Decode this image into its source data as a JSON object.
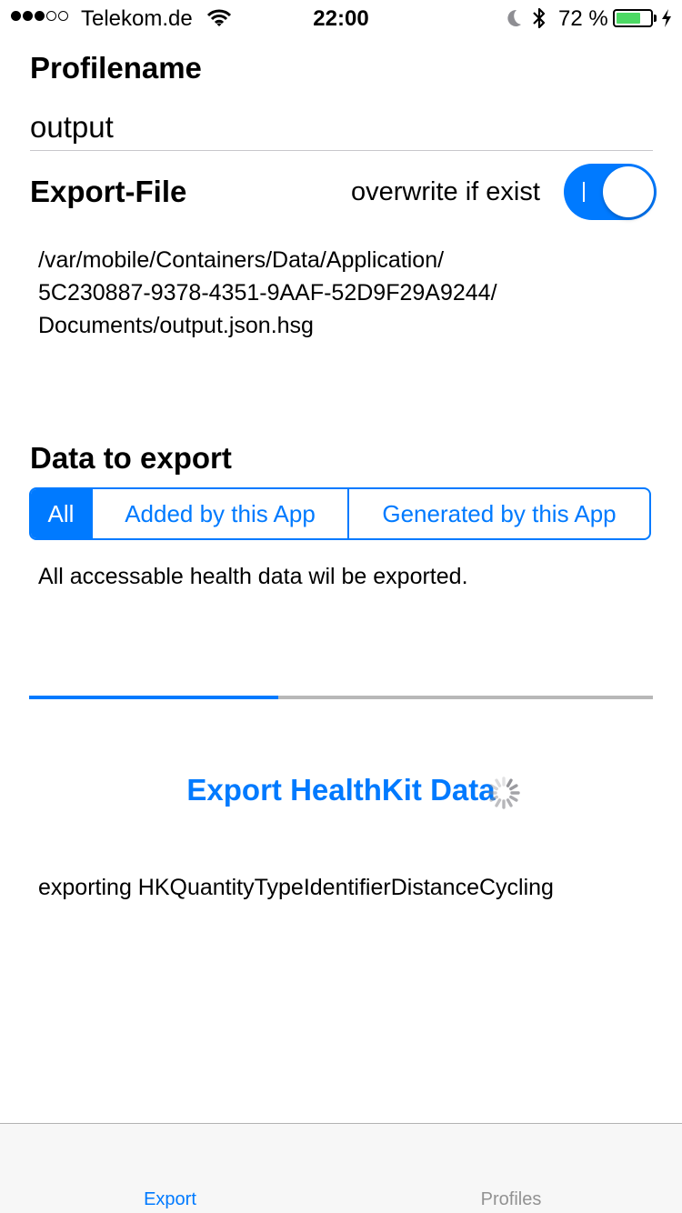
{
  "status_bar": {
    "carrier": "Telekom.de",
    "time": "22:00",
    "battery_percent": "72 %",
    "battery_level": 0.72,
    "signal_bars_filled": 3,
    "signal_bars_total": 5
  },
  "profile": {
    "title": "Profilename",
    "value": "output"
  },
  "export_file": {
    "title": "Export-File",
    "overwrite_label": "overwrite if exist",
    "overwrite_enabled": true,
    "path_lines": [
      "/var/mobile/Containers/Data/Application/",
      "5C230887-9378-4351-9AAF-52D9F29A9244/",
      "Documents/output.json.hsg"
    ]
  },
  "data_to_export": {
    "title": "Data to export",
    "segments": [
      "All",
      "Added by this App",
      "Generated by this App"
    ],
    "selected_segment": "All",
    "description": "All accessable health data wil be exported."
  },
  "progress": {
    "fraction": 0.4
  },
  "export": {
    "button_label": "Export HealthKit Data",
    "status": "exporting HKQuantityTypeIdentifierDistanceCycling"
  },
  "tab_bar": {
    "tabs": [
      "Export",
      "Profiles"
    ],
    "selected": "Export"
  },
  "colors": {
    "accent": "#007aff",
    "battery": "#4cd964",
    "inactive_tab": "#929292"
  },
  "icons": [
    "signal-strength-icon",
    "wifi-icon",
    "moon-icon",
    "bluetooth-icon",
    "battery-icon",
    "charging-bolt-icon",
    "activity-spinner-icon"
  ]
}
